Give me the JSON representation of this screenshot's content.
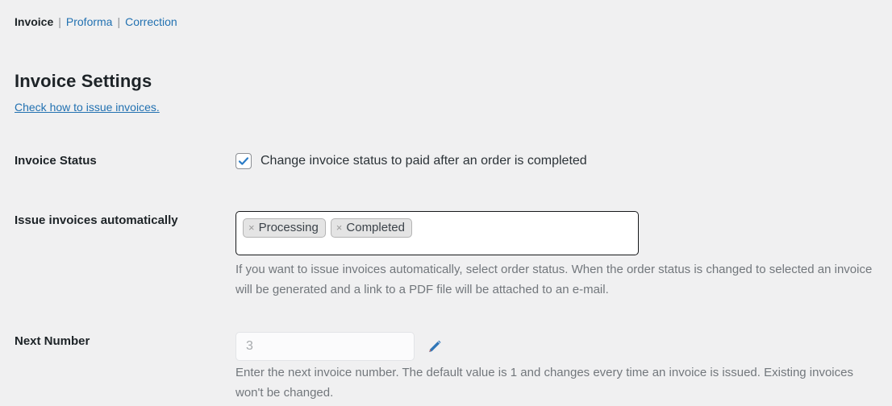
{
  "nav": {
    "items": [
      {
        "label": "Invoice",
        "current": true
      },
      {
        "label": "Proforma",
        "current": false
      },
      {
        "label": "Correction",
        "current": false
      }
    ],
    "separator": "|"
  },
  "header": {
    "title": "Invoice Settings",
    "help_link": "Check how to issue invoices."
  },
  "settings": {
    "invoice_status": {
      "label": "Invoice Status",
      "checkbox_label": "Change invoice status to paid after an order is completed",
      "checked": true
    },
    "issue_automatically": {
      "label": "Issue invoices automatically",
      "tags": [
        {
          "remove": "×",
          "label": "Processing"
        },
        {
          "remove": "×",
          "label": "Completed"
        }
      ],
      "description": "If you want to issue invoices automatically, select order status. When the order status is changed to selected an invoice will be generated and a link to a PDF file will be attached to an e-mail."
    },
    "next_number": {
      "label": "Next Number",
      "value": "3",
      "placeholder": "3",
      "edit_icon": "pencil-icon",
      "description": "Enter the next invoice number. The default value is 1 and changes every time an invoice is issued. Existing invoices won't be changed."
    }
  },
  "colors": {
    "background": "#f0f0f1",
    "link": "#2271b1",
    "text": "#1d2327",
    "muted": "#72777c",
    "accent_check": "#2b7cc7",
    "tag_bg": "#e4e4e4"
  }
}
